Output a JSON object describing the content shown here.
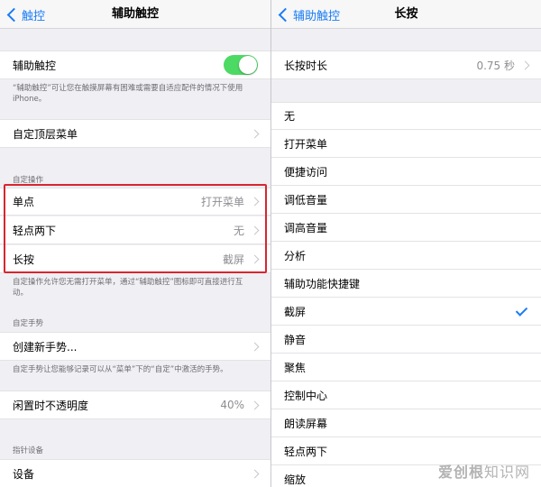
{
  "left": {
    "nav": {
      "back": "触控",
      "title": "辅助触控"
    },
    "assistive_touch": {
      "label": "辅助触控",
      "enabled": true
    },
    "assistive_desc": "“辅助触控”可让您在触摸屏幕有困难或需要自适应配件的情况下使用iPhone。",
    "top_menu": {
      "label": "自定顶层菜单"
    },
    "custom_actions_header": "自定操作",
    "actions": [
      {
        "label": "单点",
        "value": "打开菜单"
      },
      {
        "label": "轻点两下",
        "value": "无"
      },
      {
        "label": "长按",
        "value": "截屏"
      }
    ],
    "actions_desc": "自定操作允许您无需打开菜单，通过“辅助触控”图标即可直接进行互动。",
    "gestures_header": "自定手势",
    "new_gesture": {
      "label": "创建新手势..."
    },
    "gestures_desc": "自定手势让您能够记录可以从“菜单”下的“自定”中激活的手势。",
    "idle_opacity": {
      "label": "闲置时不透明度",
      "value": "40%"
    },
    "pointer_header": "指针设备",
    "devices": {
      "label": "设备"
    }
  },
  "right": {
    "nav": {
      "back": "辅助触控",
      "title": "长按"
    },
    "duration": {
      "label": "长按时长",
      "value": "0.75 秒"
    },
    "options": [
      "无",
      "打开菜单",
      "便捷访问",
      "调低音量",
      "调高音量",
      "分析",
      "辅助功能快捷键",
      "截屏",
      "静音",
      "聚焦",
      "控制中心",
      "朗读屏幕",
      "轻点两下",
      "缩放"
    ],
    "selected": "截屏"
  },
  "watermark": {
    "brand": "爱创根",
    "suffix": "知识网"
  },
  "colors": {
    "accent": "#1a7cf5",
    "toggle_on": "#4cd964",
    "highlight": "#d8262e"
  }
}
